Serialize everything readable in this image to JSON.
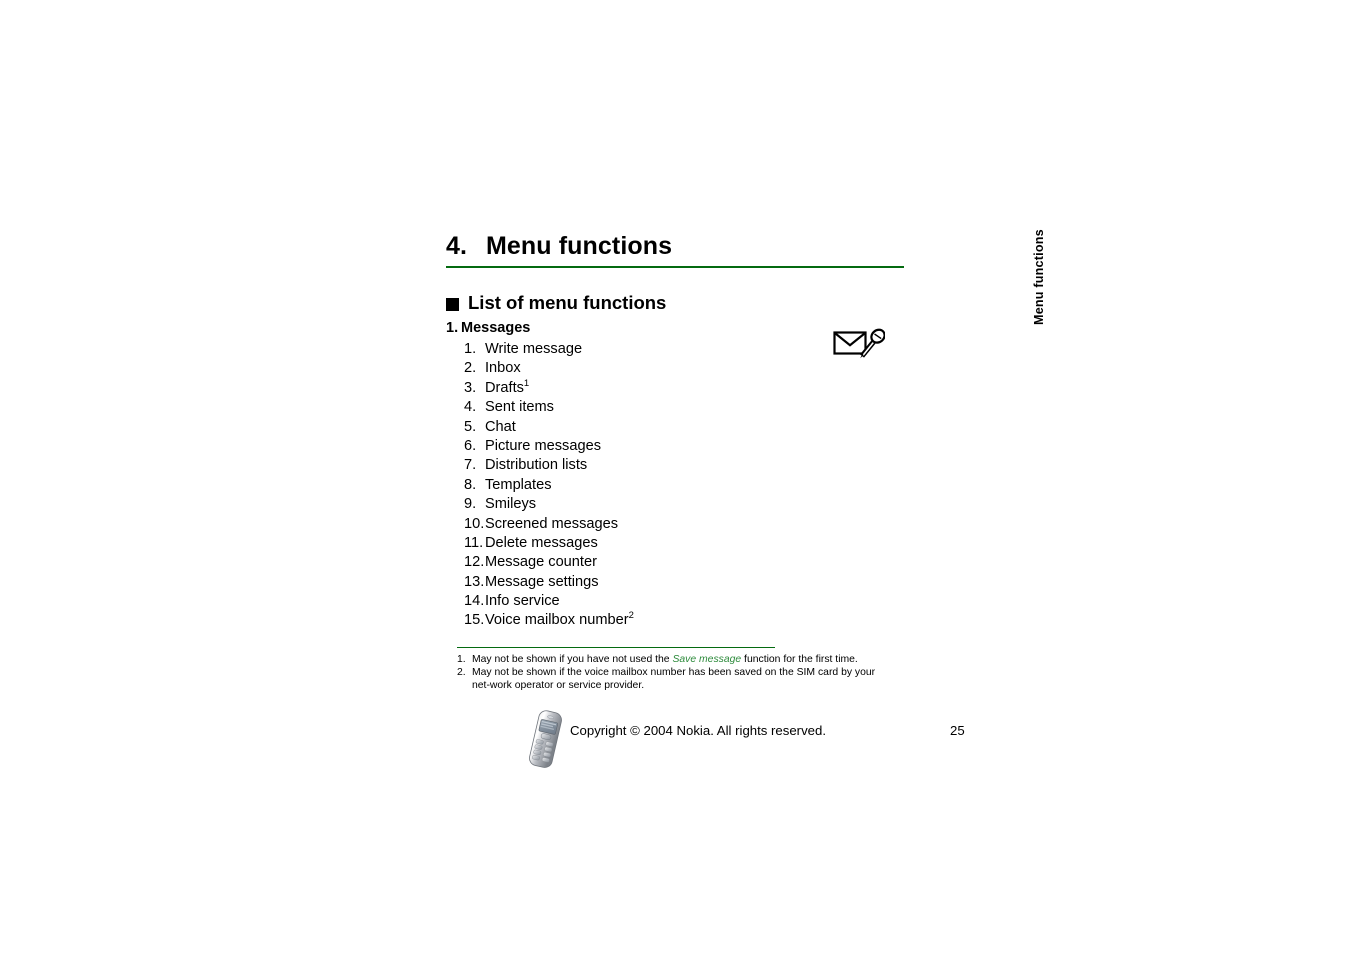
{
  "chapter": {
    "number": "4.",
    "title": "Menu functions",
    "rule_color": "#046A10"
  },
  "section": {
    "bullet_icon": "filled-square-bullet",
    "title": "List of menu functions"
  },
  "top_item": {
    "number": "1.",
    "label": "Messages",
    "icon": "envelope-with-pen-icon"
  },
  "submenu": [
    {
      "number": "1.",
      "label": "Write message",
      "footnote": ""
    },
    {
      "number": "2.",
      "label": "Inbox",
      "footnote": ""
    },
    {
      "number": "3.",
      "label": "Drafts",
      "footnote": "1"
    },
    {
      "number": "4.",
      "label": "Sent items",
      "footnote": ""
    },
    {
      "number": "5.",
      "label": "Chat",
      "footnote": ""
    },
    {
      "number": "6.",
      "label": "Picture messages",
      "footnote": ""
    },
    {
      "number": "7.",
      "label": "Distribution lists",
      "footnote": ""
    },
    {
      "number": "8.",
      "label": "Templates",
      "footnote": ""
    },
    {
      "number": "9.",
      "label": "Smileys",
      "footnote": ""
    },
    {
      "number": "10.",
      "label": "Screened messages",
      "footnote": ""
    },
    {
      "number": "11.",
      "label": "Delete messages",
      "footnote": ""
    },
    {
      "number": "12.",
      "label": "Message counter",
      "footnote": ""
    },
    {
      "number": "13.",
      "label": "Message settings",
      "footnote": ""
    },
    {
      "number": "14.",
      "label": "Info service",
      "footnote": ""
    },
    {
      "number": "15.",
      "label": "Voice mailbox number",
      "footnote": "2"
    }
  ],
  "footnotes": [
    {
      "number": "1.",
      "text_before": "May not be shown if you have not used the ",
      "emphasis": "Save message",
      "text_after": " function for the first time.",
      "emphasis_color": "#2E8B3C"
    },
    {
      "number": "2.",
      "text_before": "May not be shown if the voice mailbox number has been saved on the SIM card by your net-work operator or service provider.",
      "emphasis": "",
      "text_after": "",
      "emphasis_color": "#2E8B3C"
    }
  ],
  "footer": {
    "phone_image": "nokia-phone-photo",
    "copyright": "Copyright © 2004 Nokia. All rights reserved.",
    "page_number": "25"
  },
  "side_tab": {
    "label": "Menu functions"
  }
}
